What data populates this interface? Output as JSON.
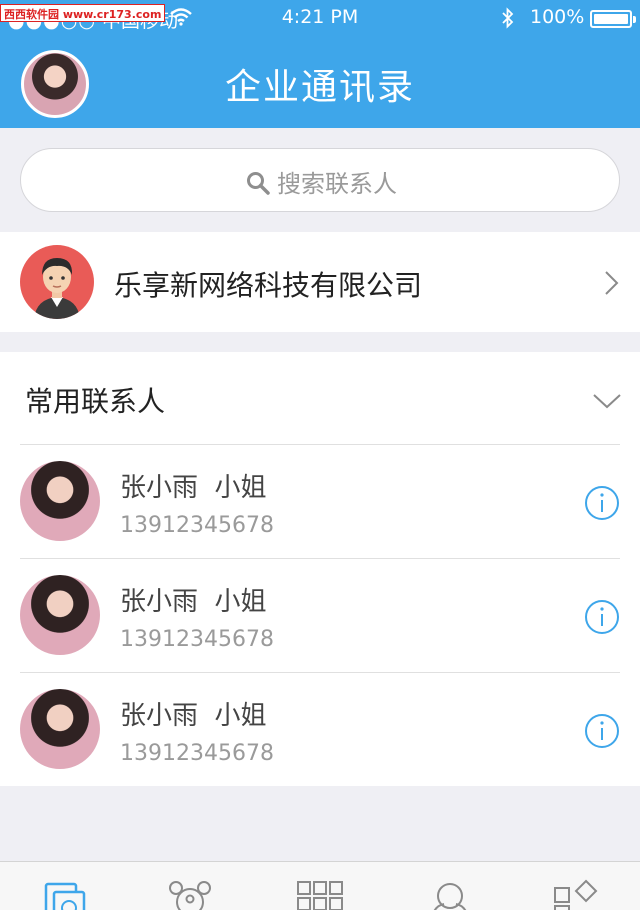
{
  "status_bar": {
    "watermark": "西西软件园 www.cr173.com",
    "carrier_dots": "●●●○○",
    "carrier": "中国移动",
    "time": "4:21 PM",
    "battery": "100%"
  },
  "header": {
    "title": "企业通讯录"
  },
  "search": {
    "placeholder": "搜索联系人"
  },
  "company": {
    "name": "乐享新网络科技有限公司"
  },
  "frequent_contacts": {
    "title": "常用联系人",
    "items": [
      {
        "name": "张小雨  小姐",
        "phone": "13912345678"
      },
      {
        "name": "张小雨  小姐",
        "phone": "13912345678"
      },
      {
        "name": "张小雨  小姐",
        "phone": "13912345678"
      }
    ]
  },
  "tabbar": {
    "icons": [
      "message-icon",
      "contacts-icon",
      "apps-icon",
      "group-icon",
      "discover-icon"
    ],
    "active_color": "#3ea6ea",
    "inactive_color": "#8a8a8a"
  },
  "colors": {
    "header_bg": "#3ea6ea",
    "page_bg": "#efeff4",
    "company_avatar_bg": "#e95b57",
    "info_icon": "#3ea6ea"
  }
}
